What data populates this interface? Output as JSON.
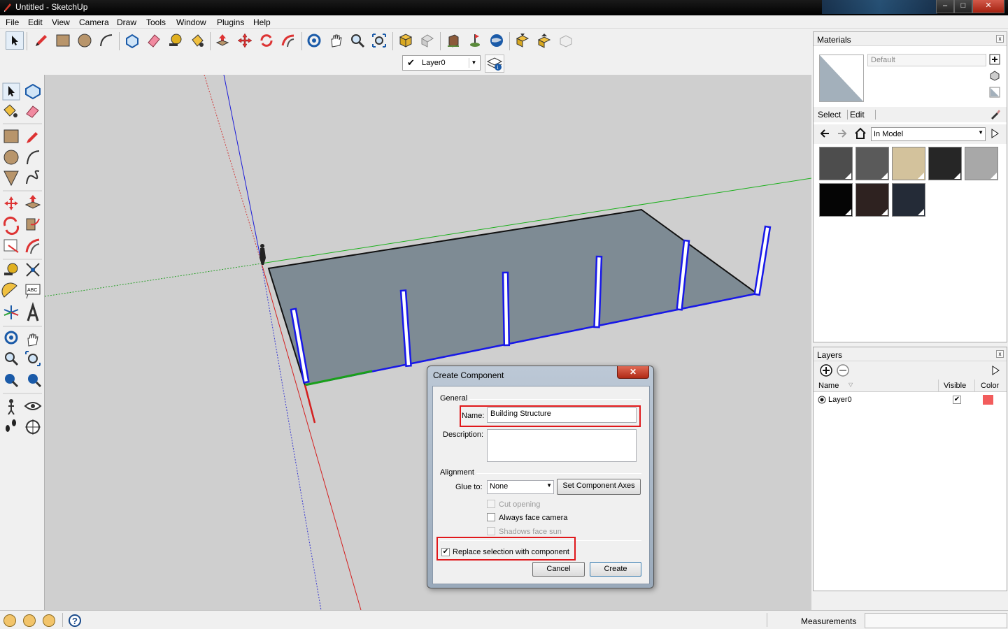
{
  "window": {
    "title": "Untitled - SketchUp",
    "min": "–",
    "max": "□",
    "close": "✕"
  },
  "menu": [
    "File",
    "Edit",
    "View",
    "Camera",
    "Draw",
    "Tools",
    "Window",
    "Plugins",
    "Help"
  ],
  "toolbar": {
    "icons": [
      "select-icon",
      "pencil-icon",
      "rectangle-icon",
      "circle-icon",
      "arc-icon",
      "make-component-icon",
      "eraser-icon",
      "tape-measure-icon",
      "paint-bucket-icon",
      "push-pull-icon",
      "move-icon",
      "rotate-icon",
      "follow-me-icon",
      "orbit-icon",
      "pan-icon",
      "zoom-icon",
      "zoom-extents-icon",
      "get-models-icon",
      "share-model-icon",
      "place-model-icon",
      "geo-location-icon",
      "google-earth-icon",
      "get-component-icon",
      "share-component-icon",
      "send-to-layout-icon"
    ],
    "layer": {
      "check": "✔",
      "label": "Layer0",
      "arrow": "▼"
    }
  },
  "left_toolbar": {
    "icons": [
      "select-icon",
      "make-component-icon",
      "paint-bucket-icon",
      "eraser-icon",
      "rectangle-icon",
      "pencil-icon",
      "circle-icon",
      "arc-icon",
      "polygon-icon",
      "freehand-icon",
      "move-icon",
      "push-pull-icon",
      "rotate-icon",
      "follow-me-icon",
      "scale-icon",
      "offset-icon",
      "tape-measure-icon",
      "dimension-icon",
      "protractor-icon",
      "text-icon",
      "axes-icon",
      "3d-text-icon",
      "orbit-icon",
      "pan-icon",
      "zoom-icon",
      "zoom-window-icon",
      "previous-view-icon",
      "zoom-extents-icon",
      "position-camera-icon",
      "look-around-icon",
      "walk-icon",
      "section-plane-icon"
    ],
    "text_label": "ABC"
  },
  "materials": {
    "title": "Materials",
    "close": "x",
    "name_placeholder": "Default",
    "tabs": [
      "Select",
      "Edit"
    ],
    "collection": "In Model",
    "arrow": "▼",
    "swatches": [
      "#4d4d4d",
      "#5a5a5a",
      "#d3c29c",
      "#262626",
      "#a8a8a8",
      "#050505",
      "#2e2220",
      "#242b37"
    ]
  },
  "layers": {
    "title": "Layers",
    "close": "x",
    "columns": [
      "Name",
      "Visible",
      "Color"
    ],
    "rows": [
      {
        "name": "Layer0",
        "visible": "✔",
        "color": "#f25c5c"
      }
    ]
  },
  "status": {
    "measurements_label": "Measurements"
  },
  "dialog": {
    "title": "Create Component",
    "close": "✕",
    "general_label": "General",
    "name_label": "Name:",
    "name_value": "Building Structure",
    "description_label": "Description:",
    "alignment_label": "Alignment",
    "glue_label": "Glue to:",
    "glue_value": "None",
    "glue_arrow": "▼",
    "set_axes_button": "Set Component Axes",
    "cut_opening": "Cut opening",
    "always_face_camera": "Always face camera",
    "shadows_face_sun": "Shadows face sun",
    "replace_selection": "Replace selection with component",
    "replace_checked": "✔",
    "cancel_button": "Cancel",
    "create_button": "Create"
  }
}
